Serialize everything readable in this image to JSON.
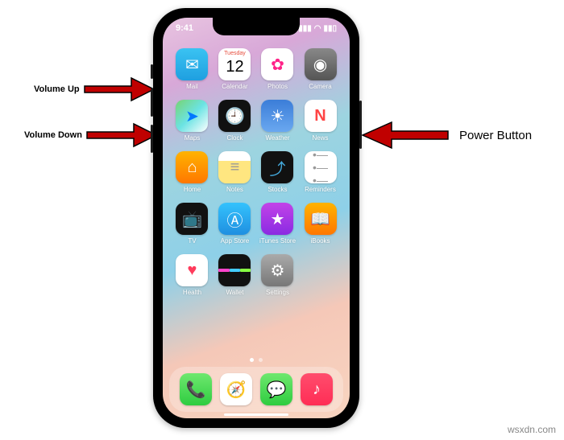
{
  "status": {
    "time": "9:41"
  },
  "calendar": {
    "day": "Tuesday",
    "date": "12"
  },
  "apps": {
    "row1": [
      {
        "label": "Mail",
        "bg": "linear-gradient(#3ac3f2,#1f9fe0)",
        "glyph": "✉"
      },
      {
        "label": "Calendar",
        "bg": "#fff"
      },
      {
        "label": "Photos",
        "bg": "#fff",
        "glyph": "❀"
      },
      {
        "label": "Camera",
        "bg": "#444",
        "glyph": "◉"
      }
    ],
    "row2": [
      {
        "label": "Maps",
        "bg": "#fff",
        "glyph": "➤"
      },
      {
        "label": "Clock",
        "bg": "#111",
        "glyph": "◷"
      },
      {
        "label": "Weather",
        "bg": "linear-gradient(#3b7dd8,#6aa8f0)",
        "glyph": "☀"
      },
      {
        "label": "News",
        "bg": "#fff",
        "glyph": "N"
      }
    ],
    "row3": [
      {
        "label": "Home",
        "bg": "linear-gradient(#ffaa00,#ff7700)",
        "glyph": "⌂"
      },
      {
        "label": "Notes",
        "bg": "#fff",
        "glyph": "≡"
      },
      {
        "label": "Stocks",
        "bg": "#111",
        "glyph": "⤴"
      },
      {
        "label": "Reminders",
        "bg": "#fff",
        "glyph": "☰"
      }
    ],
    "row4": [
      {
        "label": "TV",
        "bg": "#111",
        "glyph": "▸"
      },
      {
        "label": "App Store",
        "bg": "linear-gradient(#34c2fd,#1f8fe0)",
        "glyph": "A"
      },
      {
        "label": "iTunes Store",
        "bg": "linear-gradient(#c243e8,#8a2be2)",
        "glyph": "★"
      },
      {
        "label": "iBooks",
        "bg": "linear-gradient(#ffaa00,#ff7700)",
        "glyph": "▤"
      }
    ],
    "row5": [
      {
        "label": "Health",
        "bg": "#fff",
        "glyph": "♥"
      },
      {
        "label": "Wallet",
        "bg": "#111",
        "glyph": "▬"
      },
      {
        "label": "Settings",
        "bg": "#888",
        "glyph": "⚙"
      }
    ]
  },
  "dock": [
    {
      "name": "phone",
      "bg": "linear-gradient(#6fe86f,#2ecc40)",
      "glyph": "✆"
    },
    {
      "name": "safari",
      "bg": "#fff",
      "glyph": "◉"
    },
    {
      "name": "messages",
      "bg": "linear-gradient(#6fe86f,#2ecc40)",
      "glyph": "✉"
    },
    {
      "name": "music",
      "bg": "linear-gradient(#ff4d6d,#ff2d55)",
      "glyph": "♪"
    }
  ],
  "annotations": {
    "volup": "Volume Up",
    "voldown": "Volume Down",
    "power": "Power Button"
  },
  "watermark": "wsxdn.com"
}
